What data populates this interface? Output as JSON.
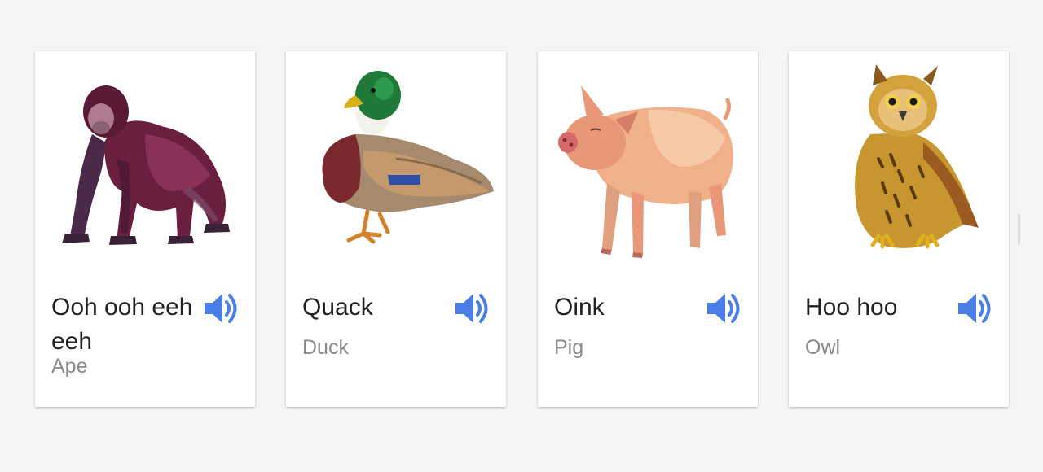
{
  "cards": [
    {
      "sound": "Ooh ooh eeh eeh",
      "animal": "Ape",
      "icon": "ape-illustration"
    },
    {
      "sound": "Quack",
      "animal": "Duck",
      "icon": "duck-illustration"
    },
    {
      "sound": "Oink",
      "animal": "Pig",
      "icon": "pig-illustration"
    },
    {
      "sound": "Hoo hoo",
      "animal": "Owl",
      "icon": "owl-illustration"
    }
  ],
  "colors": {
    "speaker": "#4a7de6",
    "sound_text": "#212121",
    "name_text": "#8a8a8a",
    "background": "#f5f5f5"
  },
  "speaker_icon": "volume-up-icon"
}
